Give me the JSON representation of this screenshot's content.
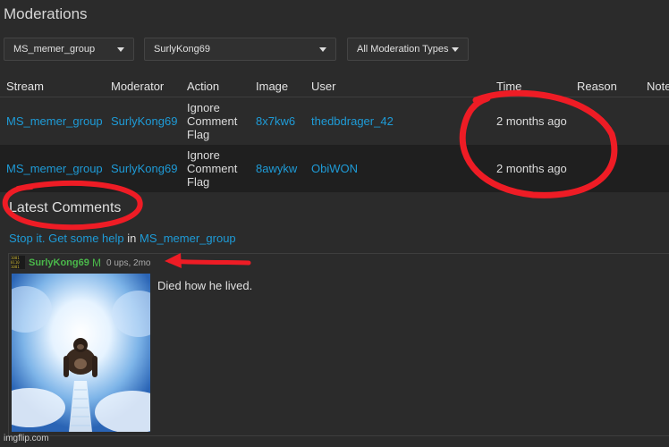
{
  "page": {
    "title": "Moderations"
  },
  "filters": {
    "stream": "MS_memer_group",
    "moderator": "SurlyKong69",
    "type": "All Moderation Types"
  },
  "table": {
    "headers": [
      "Stream",
      "Moderator",
      "Action",
      "Image",
      "User",
      "Time",
      "Reason",
      "Note"
    ],
    "rows": [
      {
        "stream": "MS_memer_group",
        "moderator": "SurlyKong69",
        "action": "Ignore Comment Flag",
        "image": "8x7kw6",
        "user": "thedbdrager_42",
        "time": "2 months ago"
      },
      {
        "stream": "MS_memer_group",
        "moderator": "SurlyKong69",
        "action": "Ignore Comment Flag",
        "image": "8awykw",
        "user": "ObiWON",
        "time": "2 months ago"
      }
    ]
  },
  "latest": {
    "heading": "Latest Comments",
    "link_text": "Stop it. Get some help",
    "in_word": "in",
    "group": "MS_memer_group",
    "comment": {
      "author": "SurlyKong69",
      "badge": "M",
      "meta": "0 ups, 2mo",
      "text": "Died how he lived."
    }
  },
  "watermark": "imgflip.com",
  "colors": {
    "link": "#1e9bd7",
    "username": "#4ab84a",
    "annotation": "#ee1c25",
    "background": "#2b2b2b"
  }
}
